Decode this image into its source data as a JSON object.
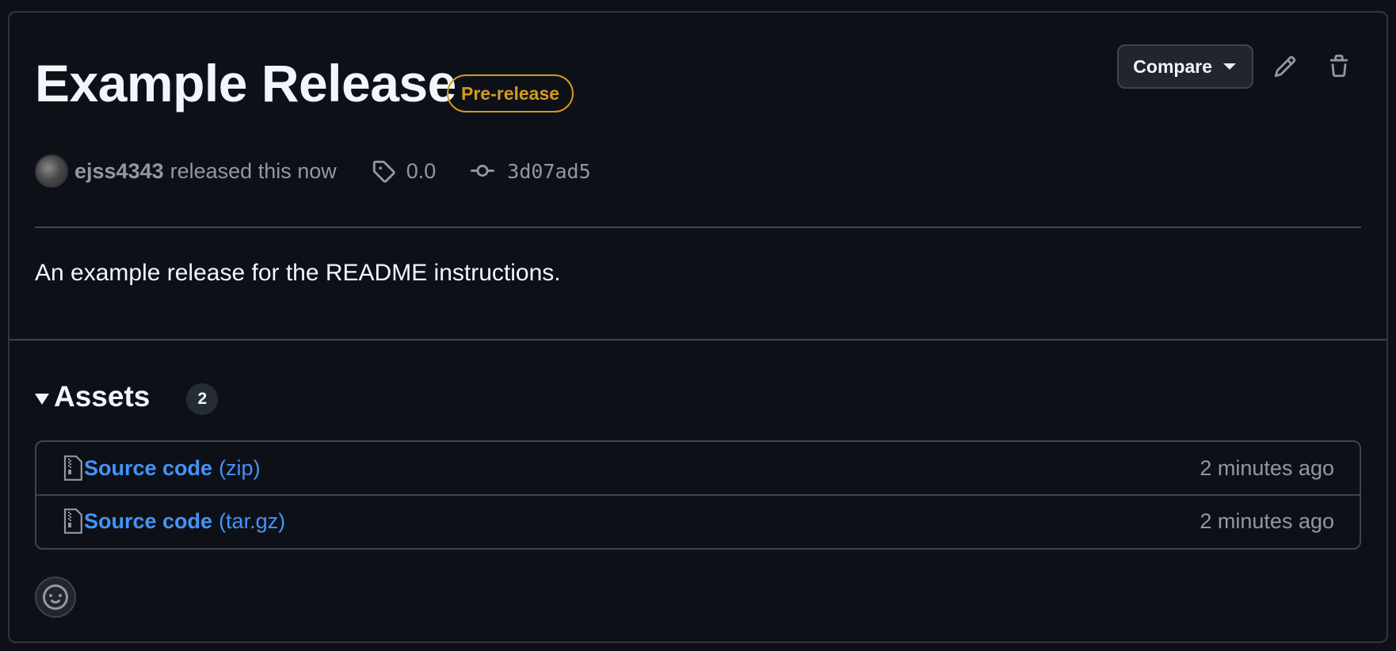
{
  "release": {
    "title": "Example Release",
    "badge": "Pre-release",
    "compare_label": "Compare",
    "author": "ejss4343",
    "released_text": "released this now",
    "tag": "0.0",
    "commit": "3d07ad5",
    "description": "An example release for the README instructions."
  },
  "assets": {
    "title": "Assets",
    "count": "2",
    "items": [
      {
        "name": "Source code",
        "ext": "(zip)",
        "time": "2 minutes ago",
        "icon": "file-zip-icon"
      },
      {
        "name": "Source code",
        "ext": "(tar.gz)",
        "time": "2 minutes ago",
        "icon": "file-zip-icon"
      }
    ]
  },
  "colors": {
    "background": "#0d1117",
    "border": "#30363d",
    "prerelease": "#d29922",
    "link": "#4493f8",
    "muted": "#9198a1"
  }
}
